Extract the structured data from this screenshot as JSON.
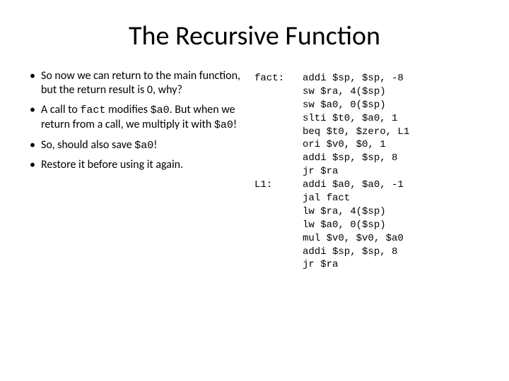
{
  "title": "The Recursive Function",
  "bullets": [
    {
      "pre": "So now we can return to the main function, but the return result is 0, why?"
    },
    {
      "pre": "A call to ",
      "code1": "fact",
      "mid1": " modifies ",
      "code2": "$a0",
      "mid2": ". But when we return from a call, we multiply it with ",
      "code3": "$a0",
      "post": "!"
    },
    {
      "pre": "So, should also save ",
      "code1": "$a0",
      "post": "!"
    },
    {
      "pre": "Restore it before using it again."
    }
  ],
  "code_labels": "fact:\n\n\n\n\n\n\n\nL1:",
  "code_body": "addi $sp, $sp, -8\nsw $ra, 4($sp)\nsw $a0, 0($sp)\nslti $t0, $a0, 1\nbeq $t0, $zero, L1\nori $v0, $0, 1\naddi $sp, $sp, 8\njr $ra\naddi $a0, $a0, -1\njal fact\nlw $ra, 4($sp)\nlw $a0, 0($sp)\nmul $v0, $v0, $a0\naddi $sp, $sp, 8\njr $ra"
}
